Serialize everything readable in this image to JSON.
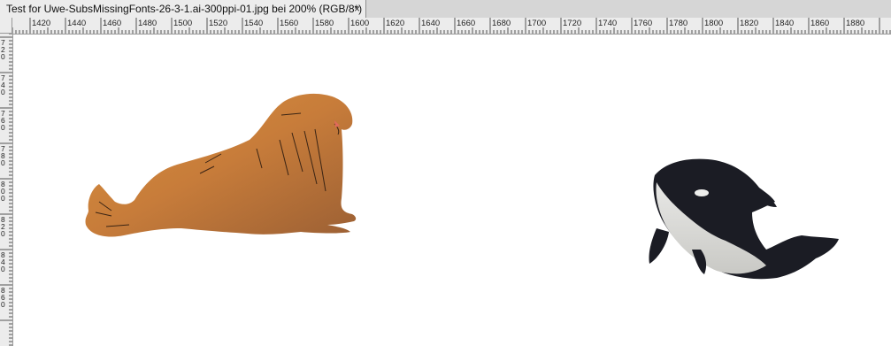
{
  "document_tab": {
    "title": "Test for Uwe-SubsMissingFonts-26-3-1.ai-300ppi-01.jpg  bei 200% (RGB/8*)",
    "close_glyph": "×"
  },
  "horizontal_ruler": {
    "labels": [
      "1420",
      "1440",
      "1460",
      "1480",
      "1500",
      "1520",
      "1540",
      "1560",
      "1580",
      "1600",
      "1620",
      "1640",
      "1660",
      "1680",
      "1700",
      "1720",
      "1740",
      "1760",
      "1780",
      "1800",
      "1820",
      "1840",
      "1860",
      "1880"
    ]
  },
  "vertical_ruler": {
    "labels": [
      "720",
      "740",
      "760",
      "780",
      "800",
      "820",
      "840",
      "860"
    ]
  },
  "canvas": {
    "objects": [
      "walrus-illustration",
      "orca-illustration"
    ]
  }
}
